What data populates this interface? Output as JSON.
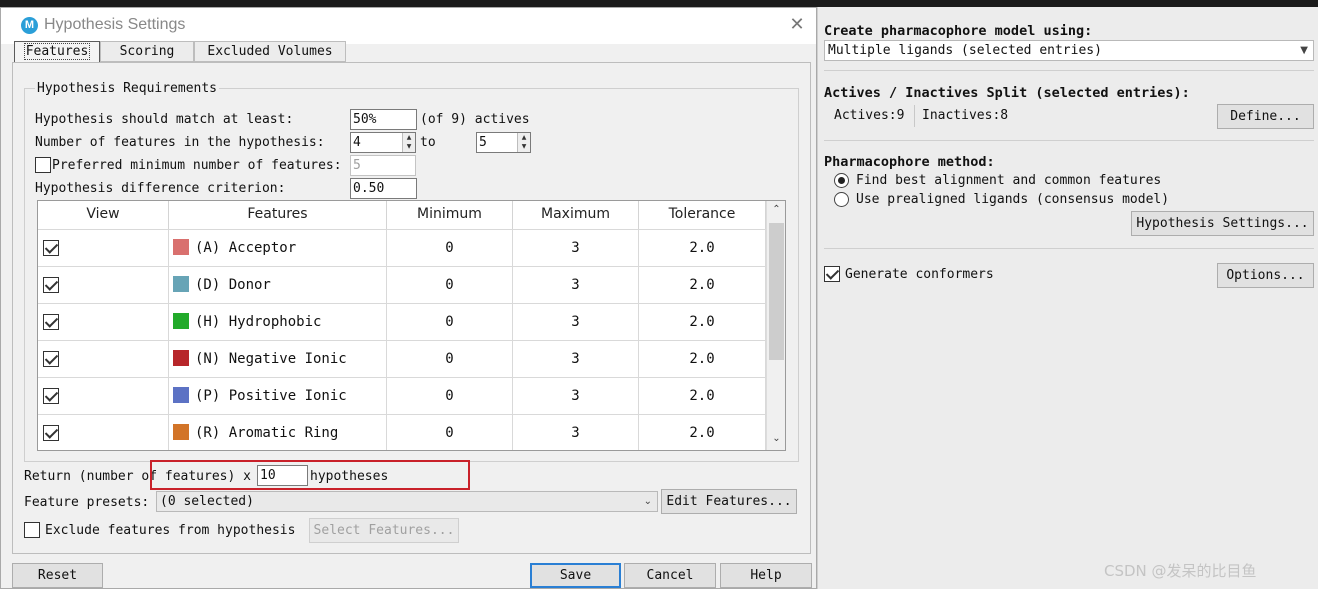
{
  "dialog": {
    "app_icon_letter": "M",
    "title": "Hypothesis Settings",
    "close_glyph": "✕",
    "tabs": [
      {
        "label": "Features",
        "active": true
      },
      {
        "label": "Scoring",
        "active": false
      },
      {
        "label": "Excluded Volumes",
        "active": false
      }
    ],
    "group_title": "Hypothesis Requirements",
    "match_label": "Hypothesis should match at least:",
    "match_value": "50%",
    "match_suffix": "(of 9) actives",
    "num_features_label": "Number of features in the hypothesis:",
    "num_features_min": "4",
    "to_label": "to",
    "num_features_max": "5",
    "preferred_label": "Preferred minimum number of features:",
    "preferred_checked": false,
    "preferred_value": "5",
    "difference_label": "Hypothesis difference criterion:",
    "difference_value": "0.50",
    "table": {
      "columns": [
        "View",
        "Features",
        "Minimum",
        "Maximum",
        "Tolerance"
      ],
      "rows": [
        {
          "view": true,
          "feature": "(A) Acceptor",
          "color": "#d9706e",
          "min": "0",
          "max": "3",
          "tol": "2.0"
        },
        {
          "view": true,
          "feature": "(D) Donor",
          "color": "#67a4b6",
          "min": "0",
          "max": "3",
          "tol": "2.0"
        },
        {
          "view": true,
          "feature": "(H) Hydrophobic",
          "color": "#22aa2a",
          "min": "0",
          "max": "3",
          "tol": "2.0"
        },
        {
          "view": true,
          "feature": "(N) Negative Ionic",
          "color": "#b7262a",
          "min": "0",
          "max": "3",
          "tol": "2.0"
        },
        {
          "view": true,
          "feature": "(P) Positive Ionic",
          "color": "#5c72c4",
          "min": "0",
          "max": "3",
          "tol": "2.0"
        },
        {
          "view": true,
          "feature": "(R) Aromatic Ring",
          "color": "#d27428",
          "min": "0",
          "max": "3",
          "tol": "2.0"
        }
      ]
    },
    "return_label": "Return (number of features) x",
    "return_value": "10",
    "return_suffix": "hypotheses",
    "presets_label": "Feature presets:",
    "presets_value": "(0 selected)",
    "edit_features_button": "Edit Features...",
    "exclude_label": "Exclude features from hypothesis",
    "exclude_checked": false,
    "select_features_button": "Select Features...",
    "reset_button": "Reset",
    "save_button": "Save",
    "cancel_button": "Cancel",
    "help_button": "Help"
  },
  "panel": {
    "create_label": "Create pharmacophore model using:",
    "source_value": "Multiple ligands (selected entries)",
    "split_label": "Actives / Inactives Split (selected entries):",
    "actives_text": "Actives:9",
    "inactives_text": "Inactives:8",
    "define_button": "Define...",
    "method_label": "Pharmacophore method:",
    "method_options": [
      {
        "label": "Find best alignment and common features",
        "selected": true
      },
      {
        "label": "Use prealigned ligands (consensus model)",
        "selected": false
      }
    ],
    "hyp_settings_button": "Hypothesis Settings...",
    "conformers_label": "Generate conformers",
    "conformers_checked": true,
    "options_button": "Options..."
  },
  "watermark": "CSDN @发呆的比目鱼"
}
